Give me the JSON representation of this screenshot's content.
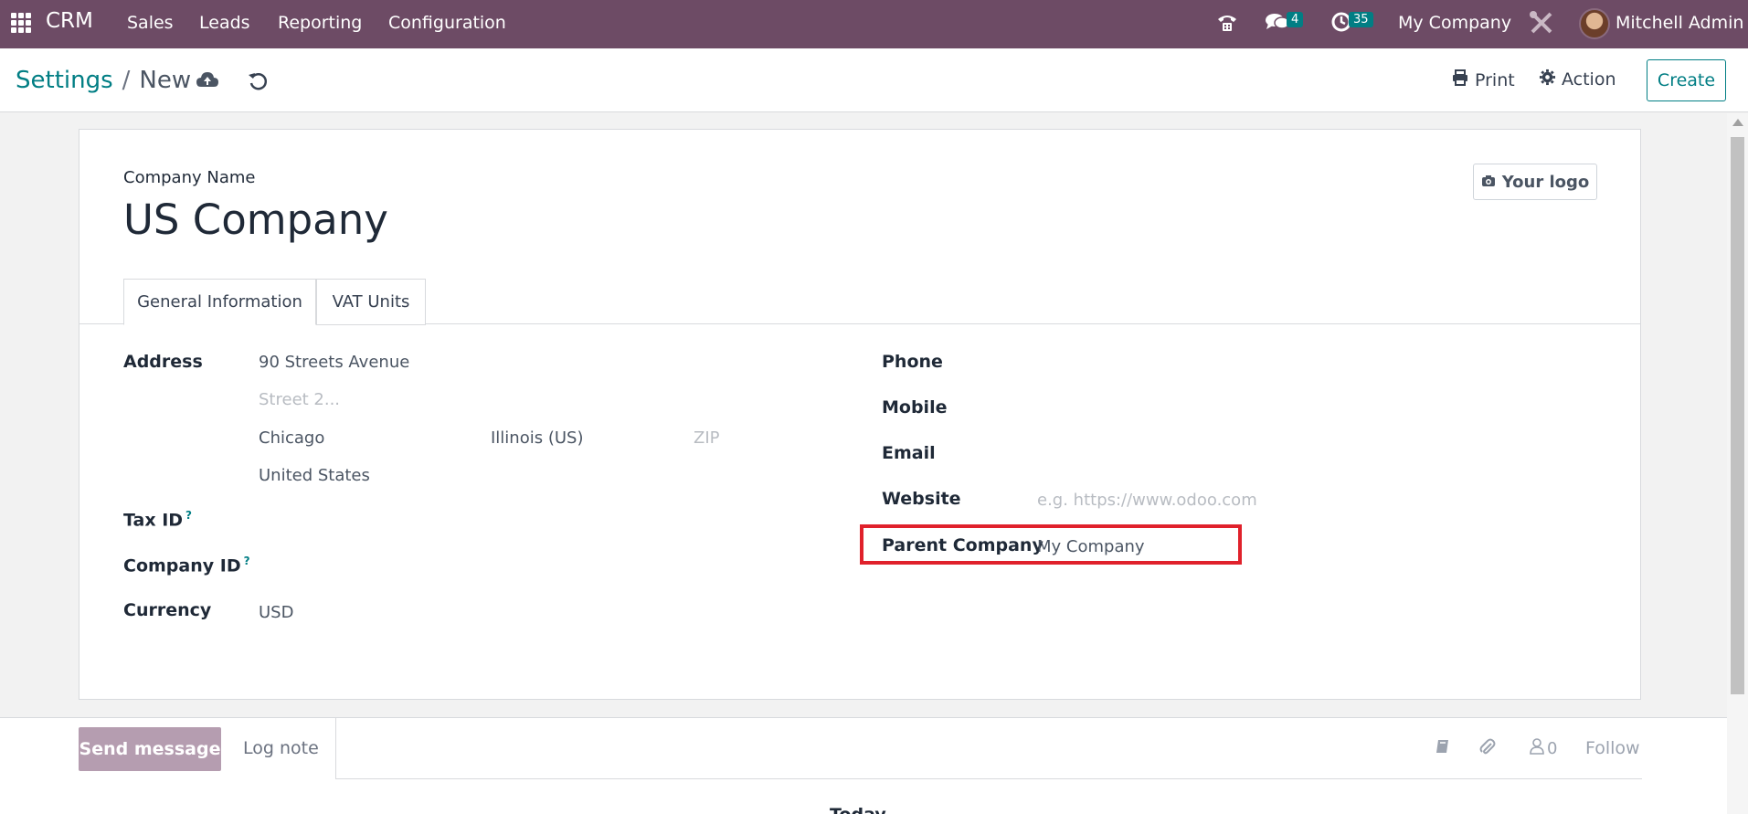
{
  "navbar": {
    "brand": "CRM",
    "menu": [
      "Sales",
      "Leads",
      "Reporting",
      "Configuration"
    ],
    "messages_count": "4",
    "activities_count": "35",
    "company": "My Company",
    "user": "Mitchell Admin"
  },
  "control_panel": {
    "breadcrumb_parent": "Settings",
    "breadcrumb_current": "New",
    "print_label": "Print",
    "action_label": "Action",
    "create_label": "Create"
  },
  "form": {
    "company_name_label": "Company Name",
    "company_name": "US Company",
    "logo_button": "Your logo",
    "tabs": [
      "General Information",
      "VAT Units"
    ],
    "address_label": "Address",
    "street": "90 Streets Avenue",
    "street2_placeholder": "Street 2...",
    "city": "Chicago",
    "state": "Illinois (US)",
    "zip_placeholder": "ZIP",
    "country": "United States",
    "tax_id_label": "Tax ID",
    "company_id_label": "Company ID",
    "currency_label": "Currency",
    "currency": "USD",
    "phone_label": "Phone",
    "mobile_label": "Mobile",
    "email_label": "Email",
    "website_label": "Website",
    "website_placeholder": "e.g. https://www.odoo.com",
    "parent_company_label": "Parent Company",
    "parent_company": "My Company",
    "help_mark": "?"
  },
  "chatter": {
    "send_message": "Send message",
    "log_note": "Log note",
    "followers_count": "0",
    "follow": "Follow",
    "cut_text": "Today"
  },
  "colors": {
    "navbar": "#6d4b65",
    "accent": "#017e84",
    "highlight": "#e0212b"
  }
}
